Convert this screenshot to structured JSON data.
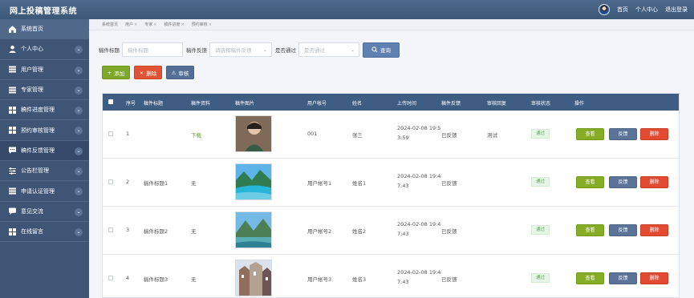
{
  "app": {
    "title": "网上投稿管理系统"
  },
  "top_nav": {
    "home": "首页",
    "profile": "个人中心",
    "logout": "退出登录"
  },
  "sidebar": {
    "items": [
      {
        "label": "系统首页",
        "icon": "home-icon"
      },
      {
        "label": "个人中心",
        "icon": "person-icon"
      },
      {
        "label": "用户管理",
        "icon": "list-icon"
      },
      {
        "label": "专家管理",
        "icon": "list-icon"
      },
      {
        "label": "稿件进度管理",
        "icon": "grid-icon"
      },
      {
        "label": "预约审核管理",
        "icon": "grid-icon"
      },
      {
        "label": "稿件反馈管理",
        "icon": "chat-icon"
      },
      {
        "label": "公告栏管理",
        "icon": "sliders-icon"
      },
      {
        "label": "申请认证管理",
        "icon": "list-icon"
      },
      {
        "label": "意见交流",
        "icon": "message-icon"
      },
      {
        "label": "在线留言",
        "icon": "grid-icon"
      }
    ]
  },
  "breadcrumbs": [
    "系统首页",
    "用户",
    "专家",
    "稿件进度",
    "预约审核"
  ],
  "search": {
    "title_label": "稿件标题",
    "title_placeholder": "稿件标题",
    "feedback_label": "稿件反馈",
    "feedback_placeholder": "请选择稿件反馈",
    "pass_label": "是否通过",
    "pass_placeholder": "是否通过",
    "query_button": "查询"
  },
  "actions": {
    "add": "添加",
    "delete": "删除",
    "audit": "审核"
  },
  "table": {
    "headers": [
      "序号",
      "稿件标题",
      "稿件资料",
      "稿件图片",
      "用户帐号",
      "姓名",
      "上传时间",
      "稿件反馈",
      "审核回复",
      "审核状态",
      "操作"
    ],
    "rows": [
      {
        "index": "1",
        "title": "",
        "material": "下载",
        "user_account": "001",
        "name": "张三",
        "upload_time_line1": "2024-02-08 19:5",
        "upload_time_line2": "3:59",
        "feedback": "已反馈",
        "reply": "测试",
        "status": "通过"
      },
      {
        "index": "2",
        "title": "稿件标题1",
        "material": "无",
        "user_account": "用户帐号1",
        "name": "姓名1",
        "upload_time_line1": "2024-02-08 19:4",
        "upload_time_line2": "7:43",
        "feedback": "已反馈",
        "reply": "",
        "status": "通过"
      },
      {
        "index": "3",
        "title": "稿件标题2",
        "material": "无",
        "user_account": "用户帐号2",
        "name": "姓名2",
        "upload_time_line1": "2024-02-08 19:4",
        "upload_time_line2": "7:43",
        "feedback": "已反馈",
        "reply": "",
        "status": "通过"
      },
      {
        "index": "4",
        "title": "稿件标题3",
        "material": "无",
        "user_account": "用户帐号3",
        "name": "姓名3",
        "upload_time_line1": "2024-02-08 19:4",
        "upload_time_line2": "7:43",
        "feedback": "已反馈",
        "reply": "",
        "status": "通过"
      }
    ],
    "operation_labels": {
      "view": "查看",
      "feedback": "反馈",
      "delete": "删除"
    }
  }
}
